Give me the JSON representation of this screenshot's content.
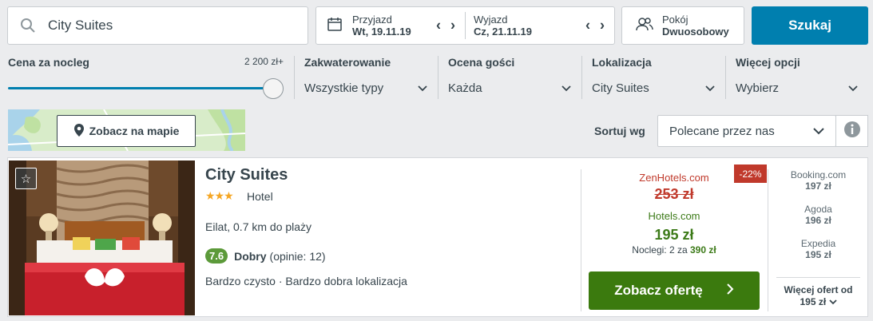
{
  "search": {
    "value": "City Suites"
  },
  "dates": {
    "checkin_label": "Przyjazd",
    "checkin_value": "Wt, 19.11.19",
    "checkout_label": "Wyjazd",
    "checkout_value": "Cz, 21.11.19"
  },
  "room": {
    "label": "Pokój",
    "value": "Dwuosobowy"
  },
  "search_button": "Szukaj",
  "filters": {
    "price": {
      "title": "Cena za nocleg",
      "max_label": "2 200 zł+",
      "level": 1.0
    },
    "lodging": {
      "title": "Zakwaterowanie",
      "value": "Wszystkie typy"
    },
    "rating": {
      "title": "Ocena gości",
      "value": "Każda"
    },
    "location": {
      "title": "Lokalizacja",
      "value": "City Suites"
    },
    "more": {
      "title": "Więcej opcji",
      "value": "Wybierz"
    }
  },
  "map_button": "Zobacz na mapie",
  "sort": {
    "label": "Sortuj wg",
    "value": "Polecane przez nas"
  },
  "hotel": {
    "name": "City Suites",
    "stars": "★★★",
    "type": "Hotel",
    "location": "Eilat, 0.7 km do plaży",
    "rating_score": "7.6",
    "rating_word": "Dobry",
    "rating_count": "(opinie: 12)",
    "features": "Bardzo czysto · Bardzo dobra lokalizacja"
  },
  "deal": {
    "discount": "-22%",
    "provider_old": "ZenHotels.com",
    "price_old": "253 zł",
    "provider": "Hotels.com",
    "price": "195 zł",
    "nights_text": "Noclegi: 2 za",
    "nights_total": "390 zł",
    "cta": "Zobacz ofertę"
  },
  "other_offers": [
    {
      "provider": "Booking.com",
      "price": "197 zł"
    },
    {
      "provider": "Agoda",
      "price": "196 zł"
    },
    {
      "provider": "Expedia",
      "price": "195 zł"
    }
  ],
  "more_offers": {
    "label": "Więcej ofert od",
    "price": "195 zł"
  },
  "colors": {
    "primary": "#007faf",
    "cta": "#3b7a0e",
    "discount": "#c0392b",
    "rating": "#5c9a3a"
  }
}
